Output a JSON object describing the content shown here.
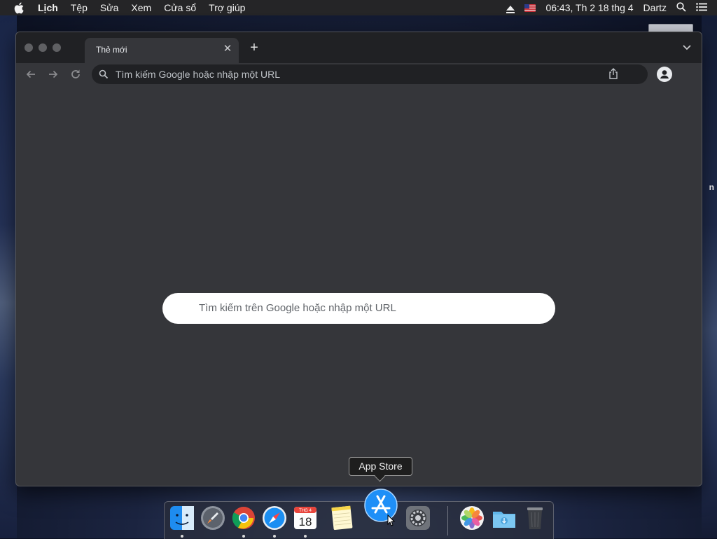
{
  "menubar": {
    "app_name": "Lịch",
    "items": [
      "Tệp",
      "Sửa",
      "Xem",
      "Cửa sổ",
      "Trợ giúp"
    ],
    "datetime": "06:43, Th 2 18 thg 4",
    "user": "Dartz"
  },
  "browser": {
    "tab_title": "Thẻ mới",
    "omnibox_placeholder": "Tìm kiếm Google hoặc nhập một URL",
    "ntp_search_placeholder": "Tìm kiếm trên Google hoặc nhập một URL"
  },
  "dock": {
    "tooltip": "App Store",
    "calendar_month": "THG 4",
    "calendar_day": "18",
    "apps": [
      "Finder",
      "Launchpad",
      "Google Chrome",
      "Safari",
      "Lịch",
      "Ghi chú",
      "App Store",
      "Tùy chọn Hệ thống",
      "Ảnh",
      "Tải về",
      "Thùng rác"
    ]
  },
  "desktop": {
    "partial_label": "n"
  },
  "colors": {
    "menubar_bg": "#252527",
    "window_bg": "#35363a",
    "titlebar_bg": "#202124",
    "omnibox_bg": "#202124"
  }
}
